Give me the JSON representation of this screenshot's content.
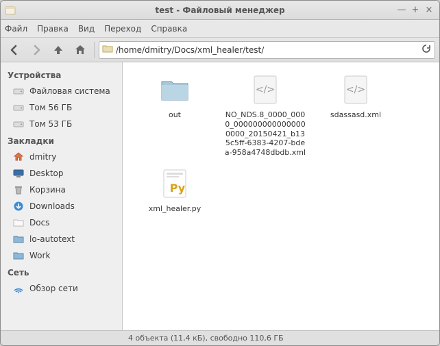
{
  "window": {
    "title": "test - Файловый менеджер"
  },
  "menu": {
    "file": "Файл",
    "edit": "Правка",
    "view": "Вид",
    "go": "Переход",
    "help": "Справка"
  },
  "path": {
    "value": "/home/dmitry/Docs/xml_healer/test/"
  },
  "sidebar": {
    "devices_heading": "Устройства",
    "devices": [
      {
        "label": "Файловая система",
        "icon": "drive"
      },
      {
        "label": "Том 56 ГБ",
        "icon": "drive"
      },
      {
        "label": "Том 53 ГБ",
        "icon": "drive"
      }
    ],
    "bookmarks_heading": "Закладки",
    "bookmarks": [
      {
        "label": "dmitry",
        "icon": "home"
      },
      {
        "label": "Desktop",
        "icon": "desktop"
      },
      {
        "label": "Корзина",
        "icon": "trash"
      },
      {
        "label": "Downloads",
        "icon": "downloads"
      },
      {
        "label": "Docs",
        "icon": "folder-plain"
      },
      {
        "label": "lo-autotext",
        "icon": "folder"
      },
      {
        "label": "Work",
        "icon": "folder"
      }
    ],
    "network_heading": "Сеть",
    "network": [
      {
        "label": "Обзор сети",
        "icon": "network"
      }
    ]
  },
  "files": [
    {
      "name": "out",
      "type": "folder"
    },
    {
      "name": "NO_NDS.8_0000_0000_0000000000000000000_20150421_b135c5ff-6383-4207-bdea-958a4748dbdb.xml",
      "type": "xml"
    },
    {
      "name": "sdassasd.xml",
      "type": "xml"
    },
    {
      "name": "xml_healer.py",
      "type": "python"
    }
  ],
  "status": {
    "text": "4 объекта (11,4 кБ), свободно 110,6 ГБ"
  }
}
